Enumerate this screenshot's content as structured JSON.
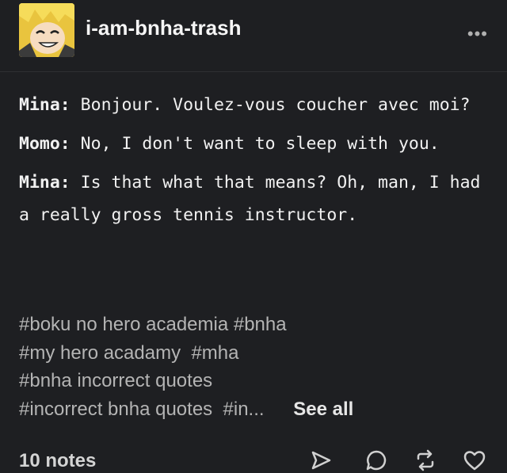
{
  "post": {
    "blog_name": "i-am-bnha-trash",
    "more_label": "•••",
    "dialogue": [
      {
        "speaker": "Mina:",
        "text": " Bonjour. Voulez-vous coucher avec moi?"
      },
      {
        "speaker": "Momo:",
        "text": " No, I don't want to sleep with you."
      },
      {
        "speaker": "Mina:",
        "text": " Is that what that means? Oh, man, I had a really gross tennis instructor."
      }
    ],
    "tags": [
      "#boku no hero academia",
      "#bnha",
      "#my hero acadamy",
      "#mha",
      "#bnha incorrect quotes",
      "#incorrect bnha quotes",
      "#in..."
    ],
    "see_all": "See all",
    "notes": "10 notes"
  },
  "icons": {
    "avatar": "anime-character-avatar",
    "more": "ellipsis-icon",
    "share": "send-icon",
    "reply": "reply-icon",
    "reblog": "reblog-icon",
    "like": "heart-icon"
  },
  "colors": {
    "background": "#1e1f22",
    "text": "#f1f1f1",
    "tags": "#b4b4b4"
  }
}
